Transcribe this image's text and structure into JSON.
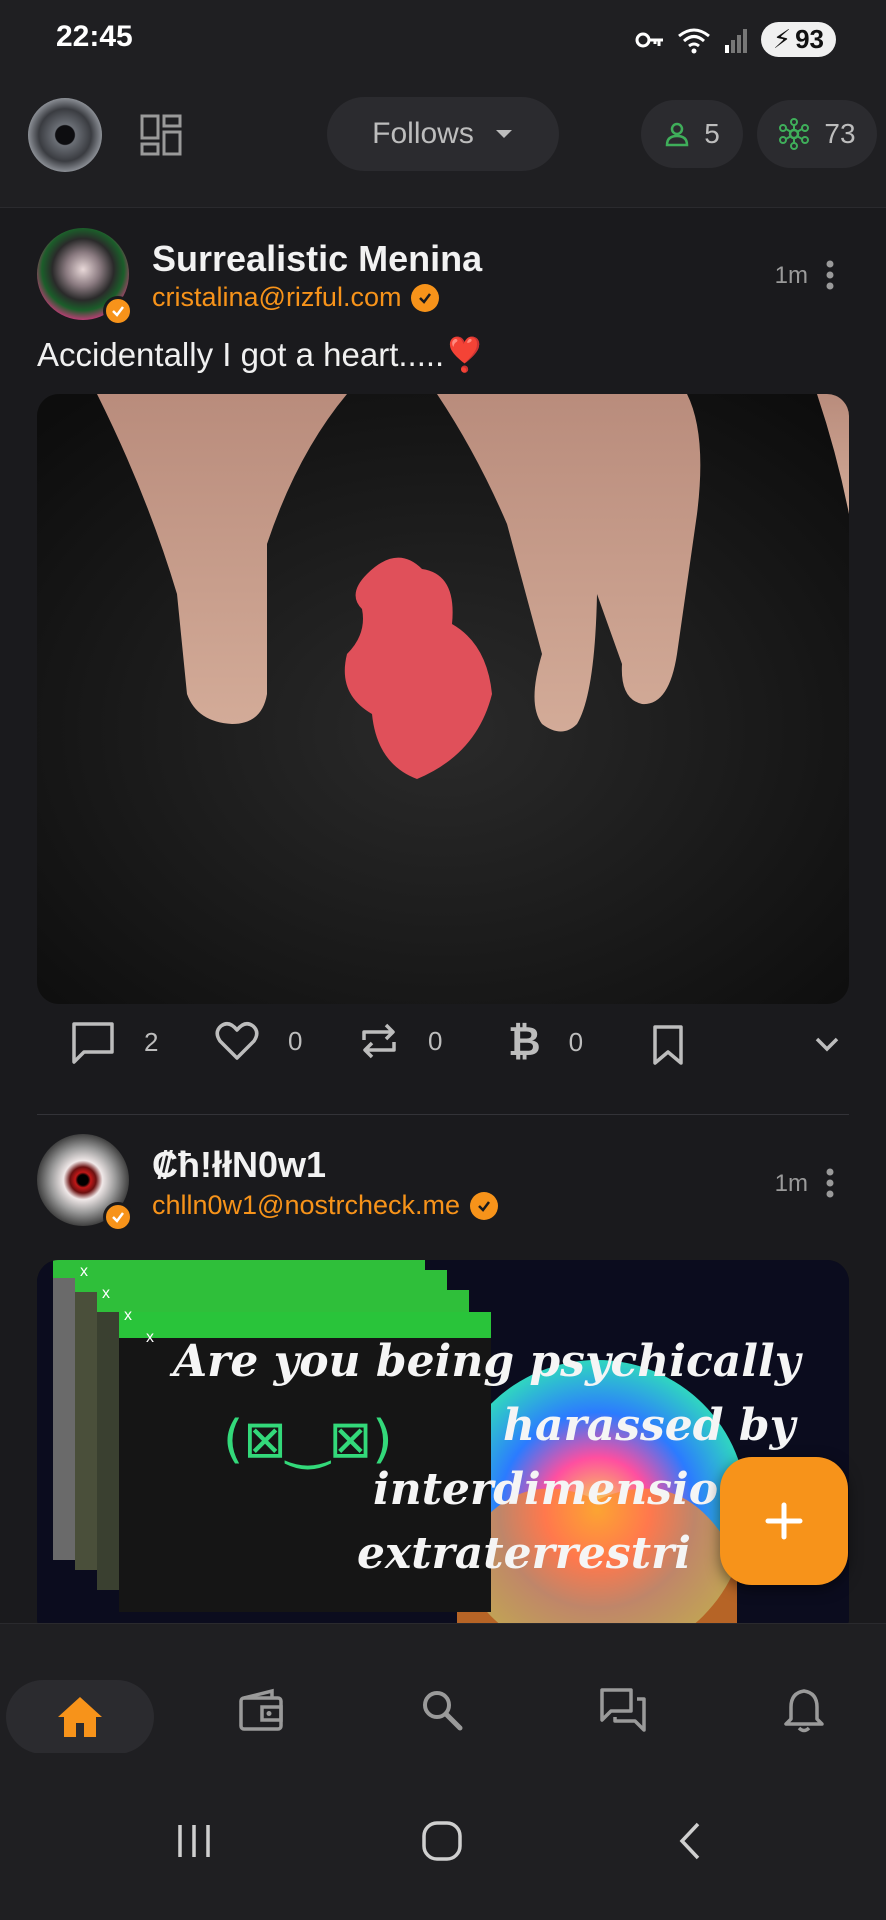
{
  "status_bar": {
    "time": "22:45",
    "battery": "93"
  },
  "top_bar": {
    "feed_selector": "Follows",
    "users_count": "5",
    "relays_count": "73"
  },
  "posts": [
    {
      "author": "Surrealistic Menina",
      "nip05": "cristalina@rizful.com",
      "time": "1m",
      "text": "Accidentally I got a heart.....❣️",
      "counts": {
        "replies": "2",
        "likes": "0",
        "reposts": "0",
        "zaps": "0"
      }
    },
    {
      "author": "₡ħ!łłN0w1",
      "nip05": "chlln0w1@nostrcheck.me",
      "time": "1m",
      "meme_lines": [
        "Are you being psychically",
        "harassed by",
        "interdimensio",
        "extraterrestri"
      ],
      "meme_face": "(⊠‿⊠)"
    }
  ],
  "colors": {
    "accent": "#f7931a",
    "background": "#1a1a1d",
    "green": "#3fae5a"
  },
  "icons": [
    "grid-icon",
    "chevron-down-icon",
    "user-icon",
    "relay-icon",
    "reply-icon",
    "heart-icon",
    "repost-icon",
    "bitcoin-icon",
    "bookmark-icon",
    "home-icon",
    "wallet-icon",
    "search-icon",
    "messages-icon",
    "bell-icon",
    "plus-icon"
  ]
}
